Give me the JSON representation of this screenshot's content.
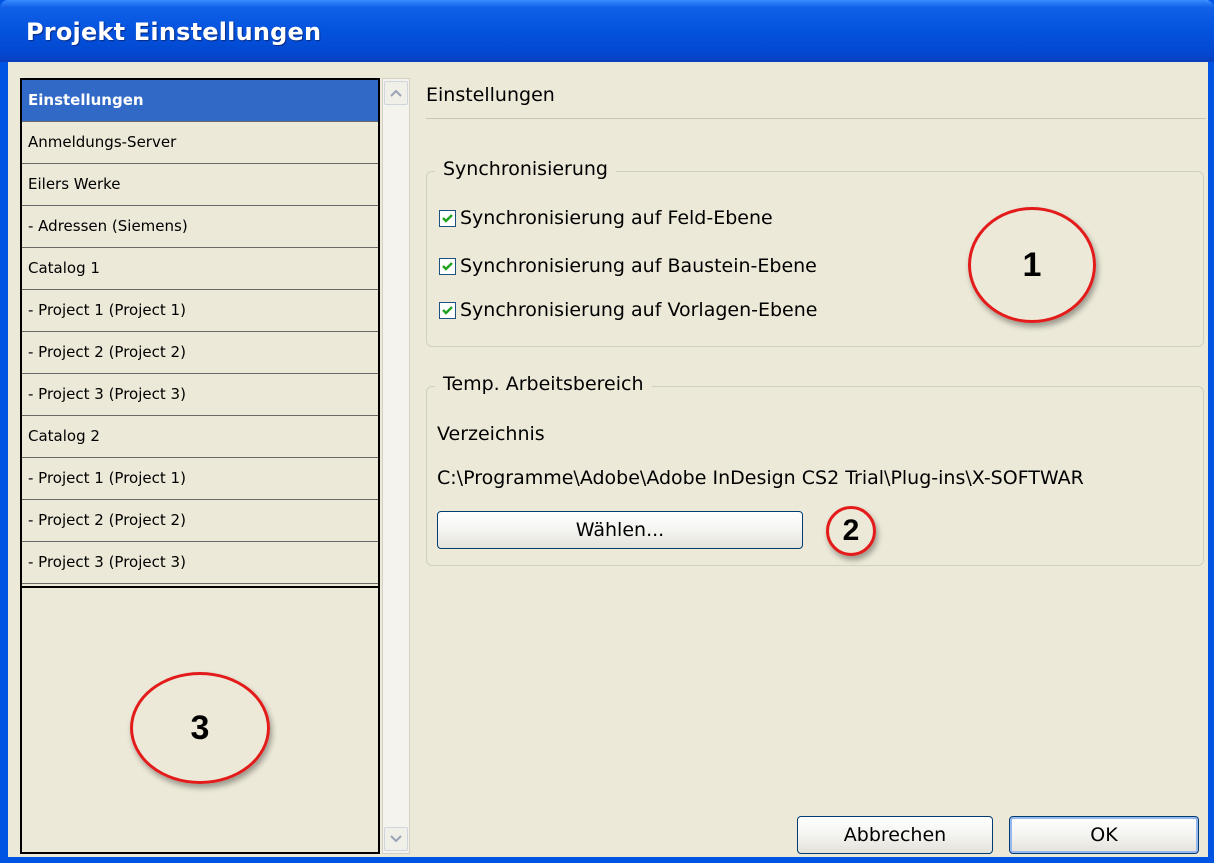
{
  "window": {
    "title": "Projekt Einstellungen"
  },
  "sidebar": {
    "items": [
      {
        "label": "Einstellungen",
        "selected": true
      },
      {
        "label": "Anmeldungs-Server",
        "selected": false
      },
      {
        "label": "Eilers Werke",
        "selected": false
      },
      {
        "label": " - Adressen (Siemens)",
        "selected": false
      },
      {
        "label": "Catalog 1",
        "selected": false
      },
      {
        "label": " - Project 1 (Project 1)",
        "selected": false
      },
      {
        "label": " - Project 2 (Project 2)",
        "selected": false
      },
      {
        "label": " - Project 3 (Project 3)",
        "selected": false
      },
      {
        "label": "Catalog 2",
        "selected": false
      },
      {
        "label": " - Project 1 (Project 1)",
        "selected": false
      },
      {
        "label": " - Project 2 (Project 2)",
        "selected": false
      },
      {
        "label": " - Project 3 (Project 3)",
        "selected": false
      }
    ]
  },
  "main": {
    "heading": "Einstellungen",
    "sync_group": {
      "legend": "Synchronisierung",
      "options": [
        {
          "label": "Synchronisierung auf Feld-Ebene",
          "checked": true
        },
        {
          "label": "Synchronisierung auf Baustein-Ebene",
          "checked": true
        },
        {
          "label": "Synchronisierung auf Vorlagen-Ebene",
          "checked": true
        }
      ]
    },
    "temp_group": {
      "legend": "Temp. Arbeitsbereich",
      "directory_label": "Verzeichnis",
      "directory_path": "C:\\Programme\\Adobe\\Adobe InDesign CS2 Trial\\Plug-ins\\X-SOFTWAR",
      "choose_label": "Wählen..."
    }
  },
  "footer": {
    "cancel_label": "Abbrechen",
    "ok_label": "OK"
  },
  "callouts": {
    "one": "1",
    "two": "2",
    "three": "3"
  },
  "colors": {
    "selection": "#3169c6",
    "titlebar": "#0453de",
    "callout": "#e31b1b",
    "background": "#ece9d8"
  }
}
